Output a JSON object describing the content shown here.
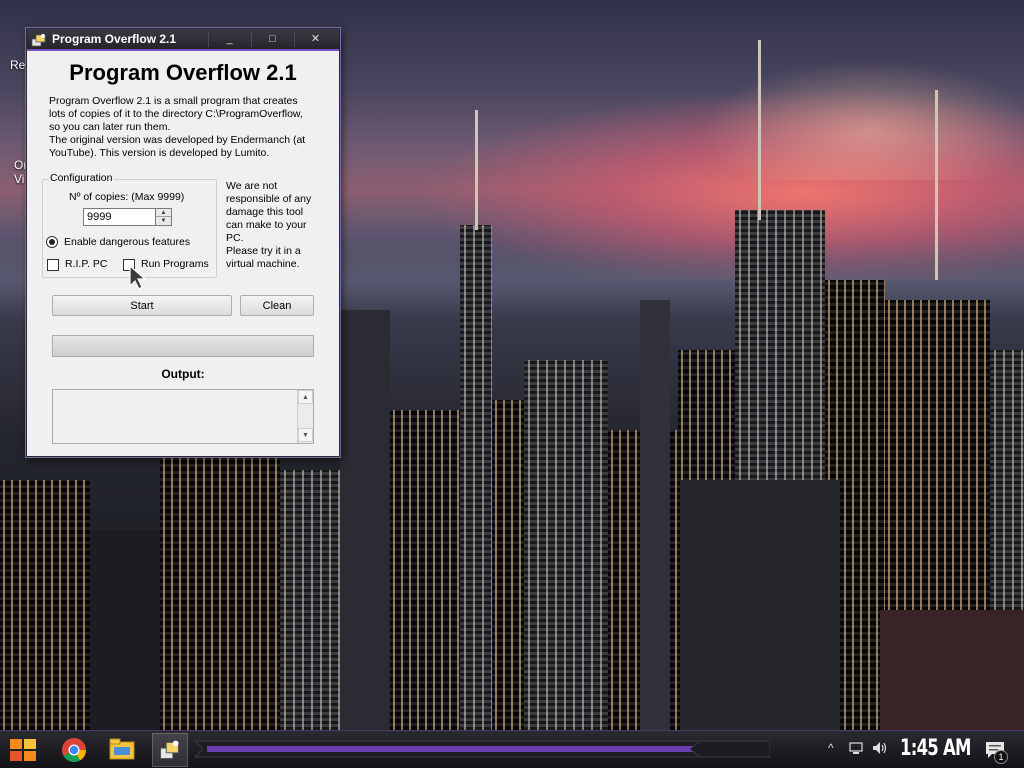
{
  "desktop": {
    "icon_labels": [
      "Re",
      "Or",
      "Vi"
    ]
  },
  "window": {
    "title": "Program Overflow 2.1",
    "controls": {
      "minimize": "_",
      "maximize": "□",
      "close": "✕"
    },
    "heading": "Program Overflow 2.1",
    "description_lines": [
      "Program Overflow 2.1 is a small program that creates",
      "lots of copies of it to the directory C:\\ProgramOverflow,",
      "so you can later run them.",
      "The original version was developed by Endermanch (at",
      "YouTube). This version is developed by Lumito."
    ],
    "config": {
      "legend": "Configuration",
      "copies_label": "Nº of copies: (Max 9999)",
      "copies_value": "9999",
      "spin_up": "▲",
      "spin_down": "▼",
      "dangerous_label": "Enable dangerous features",
      "dangerous_selected": true,
      "rip_label": "R.I.P. PC",
      "rip_checked": false,
      "run_label": "Run Programs",
      "run_checked": false
    },
    "disclaimer_lines": [
      "We are not",
      "responsible of any",
      "damage this tool",
      "can make to your",
      "PC.",
      "Please try it in a",
      "virtual machine."
    ],
    "start_label": "Start",
    "clean_label": "Clean",
    "progress_percent": 0,
    "output_label": "Output:",
    "output_text": "",
    "scroll_up": "▲",
    "scroll_down": "▼"
  },
  "taskbar": {
    "tray_up": "^",
    "clock": "1:45 AM",
    "notification_count": "1",
    "apps": [
      "chrome-icon",
      "file-explorer-icon",
      "program-overflow-icon"
    ]
  },
  "colors": {
    "title_accent": "#7a4fc4",
    "progress_fill": "#06b025",
    "taskbar_purple": "#6a3fb0"
  }
}
